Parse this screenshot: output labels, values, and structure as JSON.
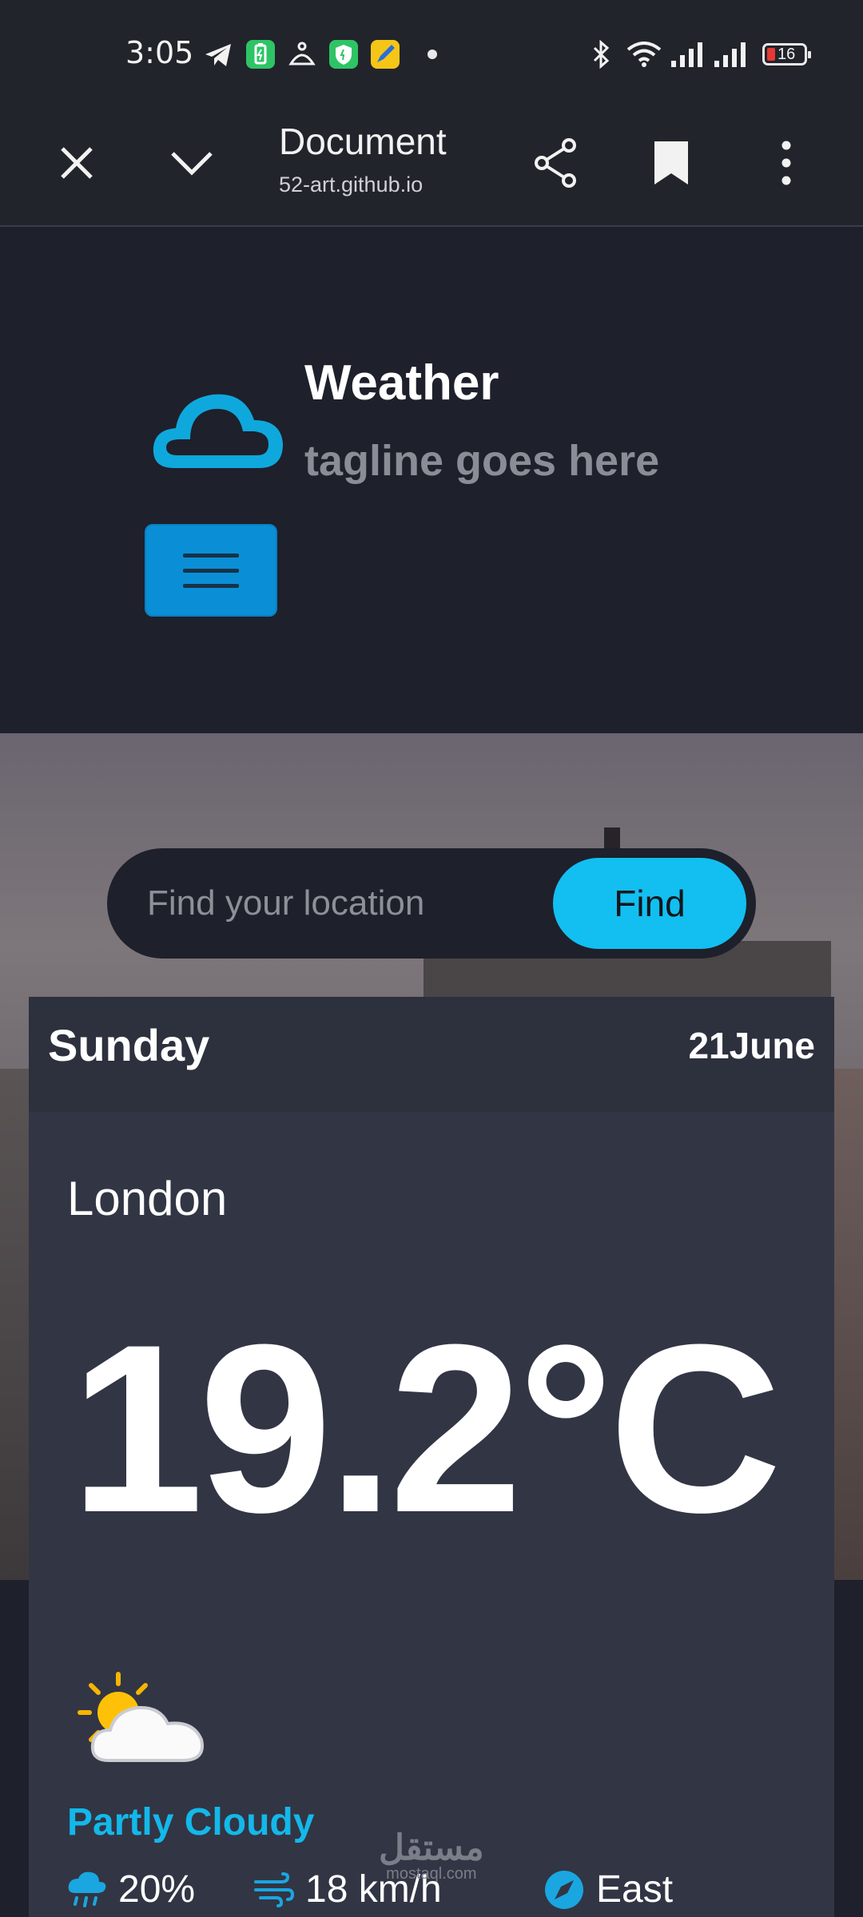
{
  "status_bar": {
    "time": "3:05",
    "battery_level": "16",
    "icons": [
      "telegram-icon",
      "battery-saver-icon",
      "cat-icon",
      "shield-icon",
      "pencil-app-icon",
      "notification-dot",
      "bluetooth-icon",
      "wifi-icon",
      "signal-icon",
      "signal-icon",
      "battery-icon"
    ]
  },
  "browser": {
    "title": "Document",
    "url": "52-art.github.io",
    "icons": [
      "close-icon",
      "chevron-down-icon",
      "share-icon",
      "bookmark-icon",
      "more-vert-icon"
    ]
  },
  "header": {
    "title": "Weather",
    "tagline": "tagline goes here",
    "logo_icon": "cloud-logo-icon",
    "menu_icon": "hamburger-menu-icon"
  },
  "search": {
    "placeholder": "Find your location",
    "button_label": "Find"
  },
  "forecast": {
    "day": "Sunday",
    "date": "21June",
    "location": "London",
    "temperature": "19.2°C",
    "condition_icon": "partly-cloudy-icon",
    "condition": "Partly Cloudy",
    "precipitation": "20%",
    "wind_speed": "18 km/h",
    "wind_direction": "East"
  },
  "watermark": {
    "arabic": "مستقل",
    "latin": "mostaql.com"
  },
  "colors": {
    "accent": "#12bff0",
    "menu_button": "#0a8fd6",
    "background": "#1e202b",
    "card": "#323544"
  }
}
